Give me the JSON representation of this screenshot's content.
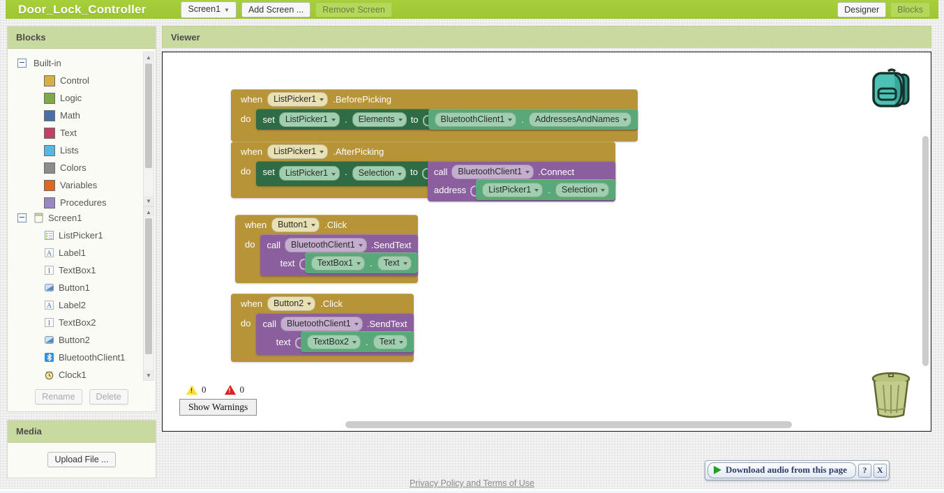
{
  "topbar": {
    "project_title": "Door_Lock_Controller",
    "screen_select": "Screen1",
    "add_screen_label": "Add Screen ...",
    "remove_screen_label": "Remove Screen",
    "designer_label": "Designer",
    "blocks_label": "Blocks",
    "accent_color": "#a5cd39"
  },
  "blocks_panel": {
    "header": "Blocks",
    "builtin_label": "Built-in",
    "builtin_items": [
      {
        "label": "Control",
        "color": "#d5b141"
      },
      {
        "label": "Logic",
        "color": "#7fa94b"
      },
      {
        "label": "Math",
        "color": "#4a6fa8"
      },
      {
        "label": "Text",
        "color": "#c43f67"
      },
      {
        "label": "Lists",
        "color": "#55b9df"
      },
      {
        "label": "Colors",
        "color": "#8c8c8c"
      },
      {
        "label": "Variables",
        "color": "#e2661f"
      },
      {
        "label": "Procedures",
        "color": "#9b86c4"
      }
    ],
    "screen_label": "Screen1",
    "components": [
      {
        "label": "ListPicker1",
        "icon": "listpicker-icon"
      },
      {
        "label": "Label1",
        "icon": "label-icon"
      },
      {
        "label": "TextBox1",
        "icon": "textbox-icon"
      },
      {
        "label": "Button1",
        "icon": "button-icon"
      },
      {
        "label": "Label2",
        "icon": "label-icon"
      },
      {
        "label": "TextBox2",
        "icon": "textbox-icon"
      },
      {
        "label": "Button2",
        "icon": "button-icon"
      },
      {
        "label": "BluetoothClient1",
        "icon": "bluetooth-icon"
      },
      {
        "label": "Clock1",
        "icon": "clock-icon"
      }
    ],
    "rename_label": "Rename",
    "delete_label": "Delete"
  },
  "media_panel": {
    "header": "Media",
    "upload_label": "Upload File ..."
  },
  "viewer": {
    "header": "Viewer",
    "backpack_icon": "backpack-icon",
    "trash_icon": "trash-can-icon",
    "warnings": {
      "warning_count": "0",
      "error_count": "0",
      "show_warnings_label": "Show Warnings"
    },
    "blocks": [
      {
        "id": "when-listpicker1-beforepicking",
        "when_label": "when",
        "component": "ListPicker1",
        "event": ".BeforePicking",
        "do_label": "do",
        "statement": {
          "kind": "set",
          "set_label": "set",
          "component": "ListPicker1",
          "property": "Elements",
          "to_label": "to",
          "value": {
            "kind": "get",
            "component": "BluetoothClient1",
            "property": "AddressesAndNames"
          }
        }
      },
      {
        "id": "when-listpicker1-afterpicking",
        "when_label": "when",
        "component": "ListPicker1",
        "event": ".AfterPicking",
        "do_label": "do",
        "statement": {
          "kind": "set",
          "set_label": "set",
          "component": "ListPicker1",
          "property": "Selection",
          "to_label": "to",
          "value": {
            "kind": "call",
            "call_label": "call",
            "component": "BluetoothClient1",
            "method": ".Connect",
            "arg_label": "address",
            "arg_value": {
              "kind": "get",
              "component": "ListPicker1",
              "property": "Selection"
            }
          }
        }
      },
      {
        "id": "when-button1-click",
        "when_label": "when",
        "component": "Button1",
        "event": ".Click",
        "do_label": "do",
        "statement": {
          "kind": "call",
          "call_label": "call",
          "component": "BluetoothClient1",
          "method": ".SendText",
          "arg_label": "text",
          "arg_value": {
            "kind": "get",
            "component": "TextBox1",
            "property": "Text"
          }
        }
      },
      {
        "id": "when-button2-click",
        "when_label": "when",
        "component": "Button2",
        "event": ".Click",
        "do_label": "do",
        "statement": {
          "kind": "call",
          "call_label": "call",
          "component": "BluetoothClient1",
          "method": ".SendText",
          "arg_label": "text",
          "arg_value": {
            "kind": "get",
            "component": "TextBox2",
            "property": "Text"
          }
        }
      }
    ]
  },
  "footer": {
    "privacy_link": "Privacy Policy and Terms of Use"
  },
  "download_widget": {
    "label": "Download audio from this page",
    "help_label": "?",
    "close_label": "X"
  }
}
